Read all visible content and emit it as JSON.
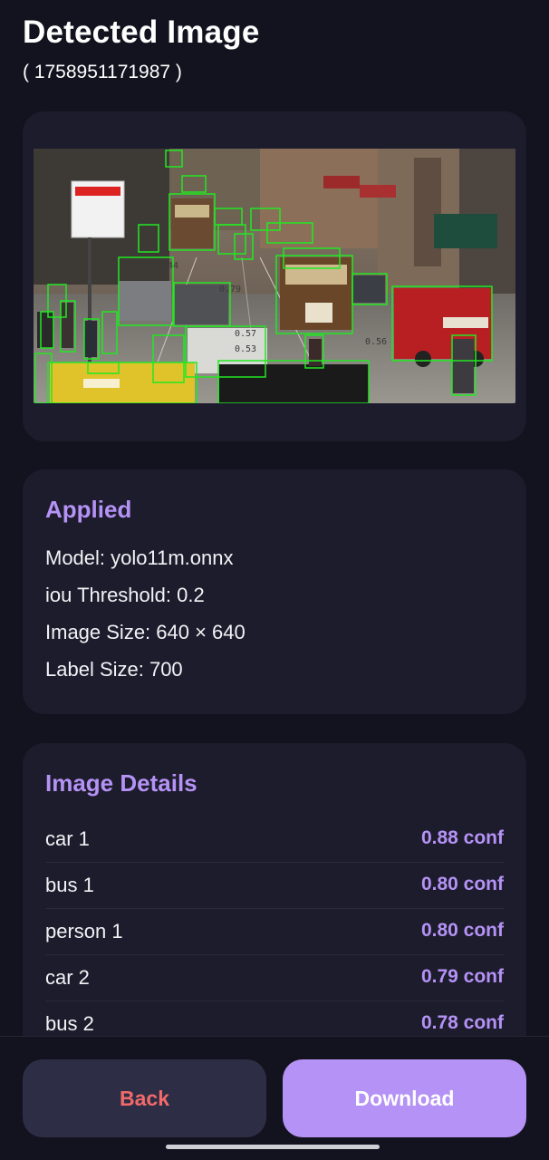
{
  "header": {
    "title": "Detected Image",
    "subtitle": "( 1758951171987 )"
  },
  "applied": {
    "title": "Applied",
    "model": "Model: yolo11m.onnx",
    "iou": "iou Threshold: 0.2",
    "image_size": "Image Size: 640 × 640",
    "label_size": "Label Size: 700"
  },
  "details": {
    "title": "Image Details",
    "rows": [
      {
        "label": "car 1",
        "conf": "0.88 conf"
      },
      {
        "label": "bus 1",
        "conf": "0.80 conf"
      },
      {
        "label": "person 1",
        "conf": "0.80 conf"
      },
      {
        "label": "car 2",
        "conf": "0.79 conf"
      },
      {
        "label": "bus 2",
        "conf": "0.78 conf"
      }
    ]
  },
  "image_overlay": {
    "labels": [
      "0.44",
      "0.79",
      "0.57",
      "0.56",
      "0.53"
    ]
  },
  "footer": {
    "back_label": "Back",
    "download_label": "Download"
  },
  "colors": {
    "accent": "#b592f5",
    "back_text": "#f06a6a",
    "card": "#1c1c2c",
    "background": "#13131f",
    "box": "#22e822"
  }
}
